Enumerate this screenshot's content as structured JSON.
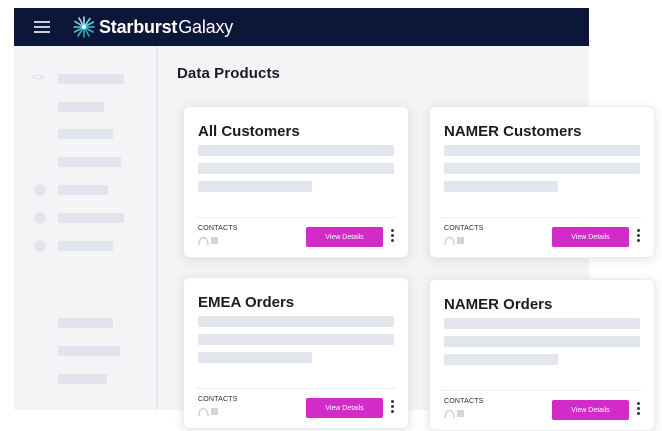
{
  "header": {
    "brand": "Starburst",
    "product": "Galaxy",
    "menu_icon": "hamburger-menu-icon",
    "logo_icon": "starburst-logo-icon",
    "background": "#0b1639"
  },
  "sidebar": {
    "code_icon": "<>"
  },
  "main": {
    "title": "Data Products"
  },
  "cards": [
    {
      "title": "All Customers",
      "contacts_label": "CONTACTS",
      "button_label": "View Details"
    },
    {
      "title": "NAMER Customers",
      "contacts_label": "CONTACTS",
      "button_label": "View Details"
    },
    {
      "title": "EMEA Orders",
      "contacts_label": "CONTACTS",
      "button_label": "View Details"
    },
    {
      "title": "NAMER Orders",
      "contacts_label": "CONTACTS",
      "button_label": "View Details"
    }
  ],
  "colors": {
    "accent": "#d22bc8",
    "placeholder": "#e4e6ee",
    "navy": "#0b1639"
  }
}
